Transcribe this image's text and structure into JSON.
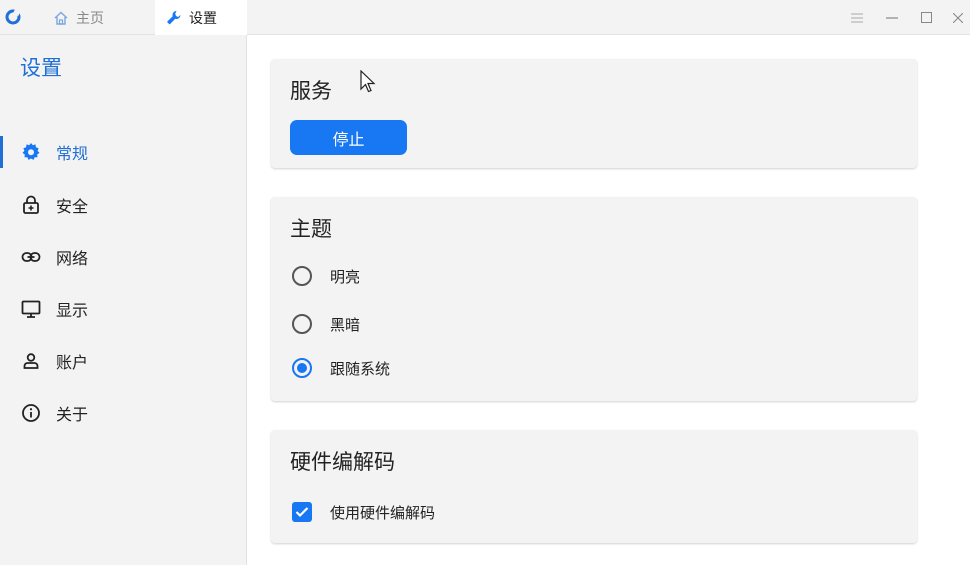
{
  "titlebar": {
    "tabs": [
      {
        "label": "主页",
        "icon": "home-icon"
      },
      {
        "label": "设置",
        "icon": "wrench-icon"
      }
    ],
    "controls": [
      "menu-icon",
      "minimize-icon",
      "maximize-icon",
      "close-icon"
    ]
  },
  "sidebar": {
    "title": "设置",
    "items": [
      {
        "label": "常规",
        "icon": "gear-icon",
        "active": true
      },
      {
        "label": "安全",
        "icon": "lock-icon"
      },
      {
        "label": "网络",
        "icon": "link-icon"
      },
      {
        "label": "显示",
        "icon": "monitor-icon"
      },
      {
        "label": "账户",
        "icon": "user-icon"
      },
      {
        "label": "关于",
        "icon": "info-icon"
      }
    ]
  },
  "service": {
    "title": "服务",
    "button_label": "停止"
  },
  "theme": {
    "title": "主题",
    "options": [
      {
        "label": "明亮",
        "checked": false
      },
      {
        "label": "黑暗",
        "checked": false
      },
      {
        "label": "跟随系统",
        "checked": true
      }
    ]
  },
  "hwcodec": {
    "title": "硬件编解码",
    "checkbox_label": "使用硬件编解码",
    "checked": true
  },
  "colors": {
    "accent": "#1877f2",
    "sidebar_bg": "#f3f3f3"
  }
}
